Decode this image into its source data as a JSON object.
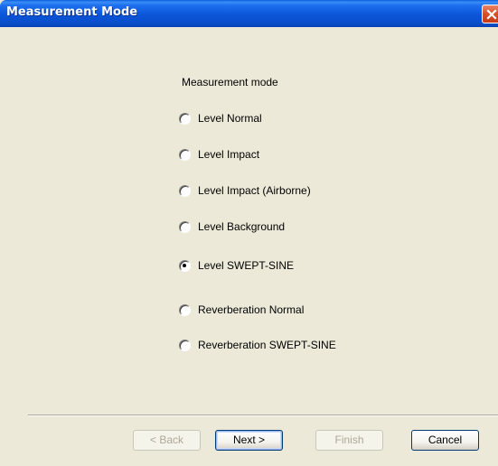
{
  "window": {
    "title": "Measurement Mode",
    "close_icon": "close-icon"
  },
  "group": {
    "label": "Measurement mode",
    "options": [
      {
        "label": "Level Normal",
        "checked": false
      },
      {
        "label": "Level Impact",
        "checked": false
      },
      {
        "label": "Level Impact (Airborne)",
        "checked": false
      },
      {
        "label": "Level Background",
        "checked": false
      },
      {
        "label": "Level SWEPT-SINE",
        "checked": true
      },
      {
        "label": "Reverberation Normal",
        "checked": false
      },
      {
        "label": "Reverberation SWEPT-SINE",
        "checked": false
      }
    ]
  },
  "buttons": {
    "back": {
      "label": "< Back",
      "enabled": false
    },
    "next": {
      "label": "Next >",
      "enabled": true
    },
    "finish": {
      "label": "Finish",
      "enabled": false
    },
    "cancel": {
      "label": "Cancel",
      "enabled": true
    }
  }
}
